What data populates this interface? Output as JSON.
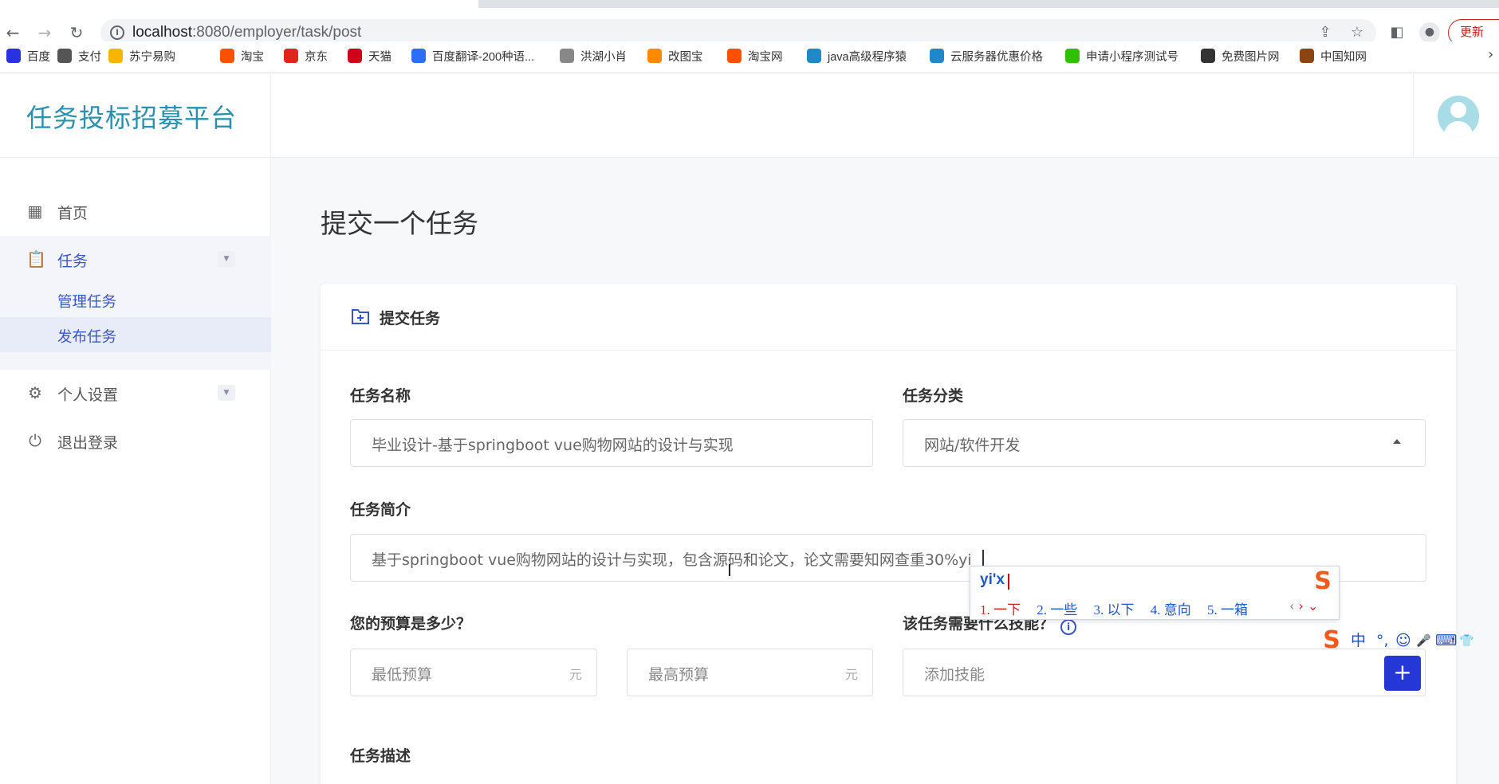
{
  "browser": {
    "url_host": "localhost",
    "url_path": ":8080/employer/task/post",
    "update_label": "更新"
  },
  "bookmarks": [
    {
      "label": "百度",
      "icon": "baidu-icon",
      "color": "#2932e1"
    },
    {
      "label": "支付",
      "icon": "pay-icon",
      "color": "#555555"
    },
    {
      "label": "苏宁易购",
      "icon": "suning-icon",
      "color": "#f7b500"
    },
    {
      "label": "淘宝",
      "icon": "taobao-icon",
      "color": "#ff5000"
    },
    {
      "label": "京东",
      "icon": "jd-icon",
      "color": "#e1251b"
    },
    {
      "label": "天猫",
      "icon": "tmall-icon",
      "color": "#d0021b"
    },
    {
      "label": "百度翻译-200种语...",
      "icon": "translate-icon",
      "color": "#2b6ff5"
    },
    {
      "label": "洪湖小肖",
      "icon": "bird-icon",
      "color": "#888888"
    },
    {
      "label": "改图宝",
      "icon": "gaitubao-icon",
      "color": "#ff8a00"
    },
    {
      "label": "淘宝网",
      "icon": "taobao-icon",
      "color": "#ff5000"
    },
    {
      "label": "java高级程序猿",
      "icon": "bilibili-icon",
      "color": "#1e88c8"
    },
    {
      "label": "云服务器优惠价格",
      "icon": "cloud-icon",
      "color": "#1e88c8"
    },
    {
      "label": "申请小程序测试号",
      "icon": "wechat-icon",
      "color": "#2dc100"
    },
    {
      "label": "免费图片网",
      "icon": "t-icon",
      "color": "#333333"
    },
    {
      "label": "中国知网",
      "icon": "cnki-icon",
      "color": "#8b4513"
    }
  ],
  "app": {
    "title": "任务投标招募平台"
  },
  "sidebar": {
    "items": [
      {
        "label": "首页",
        "icon": "dashboard-icon"
      },
      {
        "label": "任务",
        "icon": "clipboard-icon"
      },
      {
        "label": "个人设置",
        "icon": "gear-icon"
      },
      {
        "label": "退出登录",
        "icon": "power-icon"
      }
    ],
    "sub_items": [
      {
        "label": "管理任务"
      },
      {
        "label": "发布任务"
      }
    ]
  },
  "page": {
    "title": "提交一个任务"
  },
  "form": {
    "card_title": "提交任务",
    "name_label": "任务名称",
    "name_value": "毕业设计-基于springboot vue购物网站的设计与实现",
    "category_label": "任务分类",
    "category_value": "网站/软件开发",
    "intro_label": "任务简介",
    "intro_value": "基于springboot vue购物网站的设计与实现，包含源码和论文，论文需要知网查重30%yi",
    "budget_label": "您的预算是多少？",
    "min_placeholder": "最低预算",
    "max_placeholder": "最高预算",
    "unit": "元",
    "skills_label": "该任务需要什么技能？",
    "skills_placeholder": "添加技能",
    "add_label": "+",
    "desc_label": "任务描述"
  },
  "ime": {
    "pinyin": "yi'x",
    "candidates": [
      "1. 一下",
      "2. 一些",
      "3. 以下",
      "4. 意向",
      "5. 一箱"
    ],
    "toolbar": [
      "中",
      "°,",
      "☺",
      "🎤",
      "⌨",
      "👕"
    ]
  }
}
